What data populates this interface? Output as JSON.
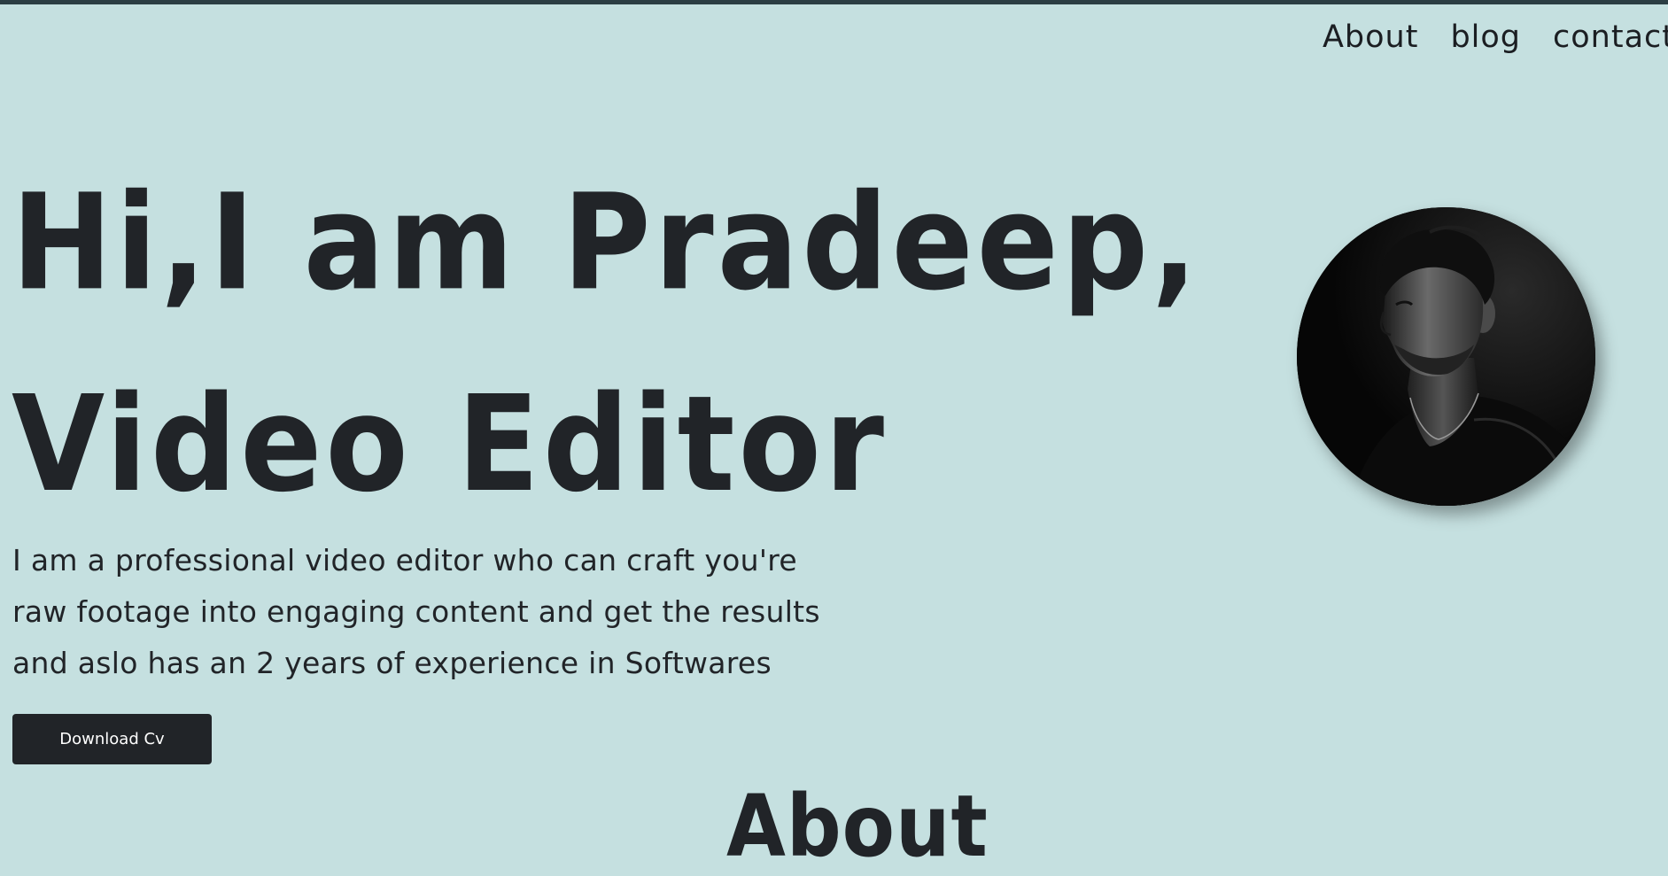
{
  "nav": {
    "items": [
      "About",
      "blog",
      "contact"
    ]
  },
  "hero": {
    "title_line1": "Hi,I am Pradeep,",
    "title_line2": "Video Editor",
    "desc_line1": "I am a professional video editor who can craft you're",
    "desc_line2": "raw footage into engaging content and get the results",
    "desc_line3": "and aslo has an 2 years of experience in Softwares",
    "button_label": "Download Cv"
  },
  "about": {
    "heading": "About"
  },
  "colors": {
    "background": "#c5e0e0",
    "text": "#212428",
    "button_bg": "#212428",
    "button_text": "#ffffff",
    "top_bar": "#2c3e44"
  }
}
